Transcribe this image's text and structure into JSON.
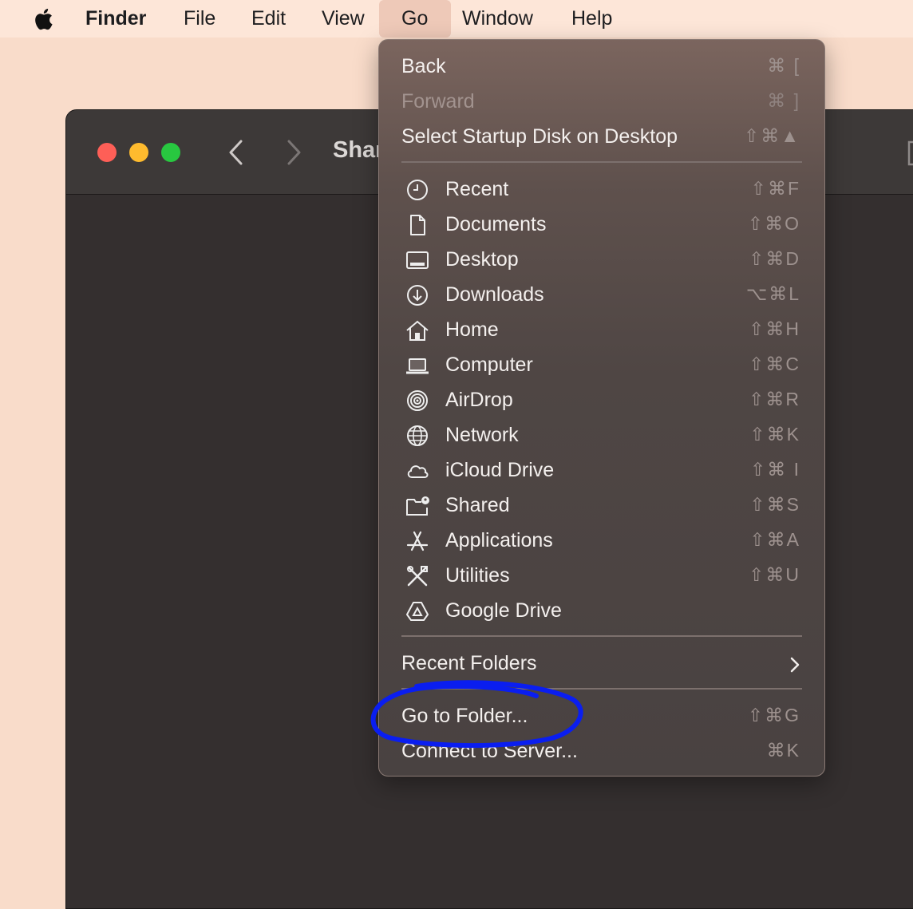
{
  "menubar": {
    "app_name": "Finder",
    "items": [
      "File",
      "Edit",
      "View",
      "Go",
      "Window",
      "Help"
    ],
    "active_item": "Go"
  },
  "window": {
    "title_partial": "Shar",
    "traffic_lights": {
      "close": "#fe5f57",
      "minimize": "#febb2e",
      "zoom": "#28c840"
    }
  },
  "go_menu": {
    "top_items": [
      {
        "label": "Back",
        "shortcut": "⌘ [",
        "disabled": false
      },
      {
        "label": "Forward",
        "shortcut": "⌘ ]",
        "disabled": true
      },
      {
        "label": "Select Startup Disk on Desktop",
        "shortcut": "⇧⌘▲",
        "disabled": false
      }
    ],
    "locations": [
      {
        "label": "Recent",
        "icon": "clock-icon",
        "shortcut": "⇧⌘F"
      },
      {
        "label": "Documents",
        "icon": "document-icon",
        "shortcut": "⇧⌘O"
      },
      {
        "label": "Desktop",
        "icon": "desktop-icon",
        "shortcut": "⇧⌘D"
      },
      {
        "label": "Downloads",
        "icon": "download-icon",
        "shortcut": "⌥⌘L"
      },
      {
        "label": "Home",
        "icon": "home-icon",
        "shortcut": "⇧⌘H"
      },
      {
        "label": "Computer",
        "icon": "laptop-icon",
        "shortcut": "⇧⌘C"
      },
      {
        "label": "AirDrop",
        "icon": "airdrop-icon",
        "shortcut": "⇧⌘R"
      },
      {
        "label": "Network",
        "icon": "globe-icon",
        "shortcut": "⇧⌘K"
      },
      {
        "label": "iCloud Drive",
        "icon": "cloud-icon",
        "shortcut": "⇧⌘ I"
      },
      {
        "label": "Shared",
        "icon": "shared-folder-icon",
        "shortcut": "⇧⌘S"
      },
      {
        "label": "Applications",
        "icon": "applications-icon",
        "shortcut": "⇧⌘A"
      },
      {
        "label": "Utilities",
        "icon": "utilities-icon",
        "shortcut": "⇧⌘U"
      },
      {
        "label": "Google Drive",
        "icon": "google-drive-icon",
        "shortcut": ""
      }
    ],
    "recent_folders": {
      "label": "Recent Folders",
      "icon": "chevron-right-icon"
    },
    "bottom_items": [
      {
        "label": "Go to Folder...",
        "shortcut": "⇧⌘G"
      },
      {
        "label": "Connect to Server...",
        "shortcut": "⌘K"
      }
    ],
    "highlight_color": "#0a1ef0"
  }
}
